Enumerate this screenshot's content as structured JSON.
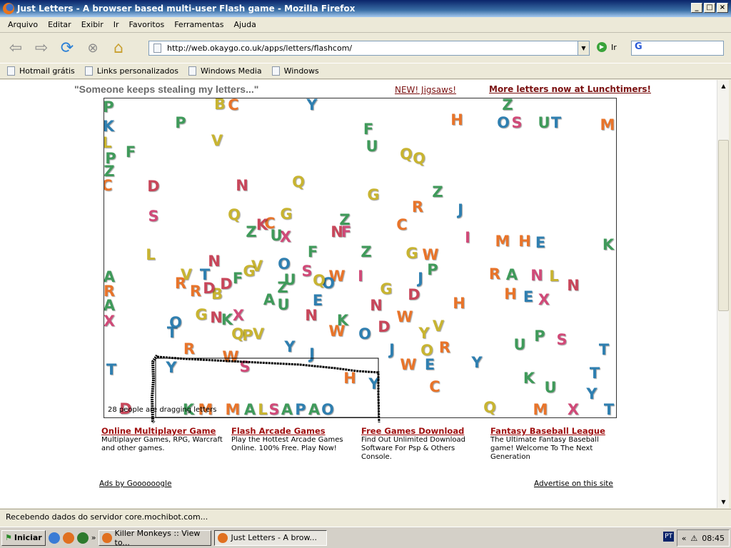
{
  "window": {
    "title": "Just Letters - A browser based multi-user Flash game - Mozilla Firefox"
  },
  "menu": [
    "Arquivo",
    "Editar",
    "Exibir",
    "Ir",
    "Favoritos",
    "Ferramentas",
    "Ajuda"
  ],
  "nav": {
    "url": "http://web.okaygo.co.uk/apps/letters/flashcom/",
    "go_label": "Ir",
    "search_value": "G"
  },
  "bookmarks": [
    "Hotmail grátis",
    "Links personalizados",
    "Windows Media",
    "Windows"
  ],
  "page": {
    "tagline": "\"Someone keeps stealing my letters...\"",
    "jigsaws_link": "NEW! Jigsaws!",
    "more_link": "More letters now at Lunchtimers!",
    "game": {
      "people_count_text": "28 people are dragging letters",
      "letters": "PKLPZCFPBCYVDNQSQGZKCUXZNFFUQQGZRJCIHZOSUTMMHEKLNOFZGWARAXVTRRDBDFGVUZSQOWIJPGDRANLNHEXAUENHOTGNKXQPVNKWODWYVYJRWSJORWEYUPSTTYHYCKUTYDKMMALSAPAOQMXT",
      "letter_colors": "gtyggoggyotyrrypyygrogpgrpggyyygotopogtpgtoootgyrtggyogogpytooryrgyyggpytoptgyrogpyrotpggtrottyrgpyyyrgotroyyttooptyoottggptttotoggttrgoogypgtgtyopt",
      "palette": {
        "g": "#3f9a5a",
        "t": "#2f7fb0",
        "y": "#c8b431",
        "o": "#e8742a",
        "r": "#c8465a",
        "p": "#d04a78"
      }
    },
    "ads": [
      {
        "title": "Online Multiplayer Game",
        "text": "Multiplayer Games, RPG, Warcraft and other games."
      },
      {
        "title": "Flash Arcade Games",
        "text": "Play the Hottest Arcade Games Online. 100% Free. Play Now!"
      },
      {
        "title": "Free Games Download",
        "text": "Find Out Unlimited Download Software For Psp & Others Console."
      },
      {
        "title": "Fantasy Baseball League",
        "text": "The Ultimate Fantasy Baseball game! Welcome To The Next Generation"
      }
    ],
    "ads_by": "Ads by Goooooogle",
    "advertise": "Advertise on this site"
  },
  "status": "Recebendo dados do servidor core.mochibot.com...",
  "taskbar": {
    "start": "Iniciar",
    "items": [
      "Killer Monkeys :: View to...",
      "Just Letters - A brow..."
    ],
    "lang": "PT",
    "clock": "08:45"
  }
}
